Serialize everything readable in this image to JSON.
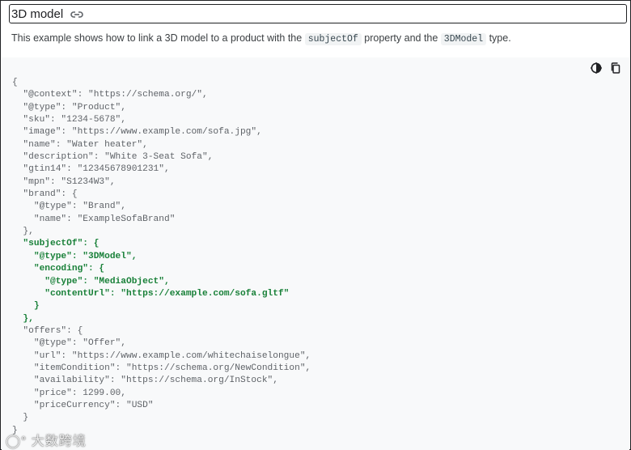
{
  "header": {
    "title": "3D model",
    "link_icon": "link-icon"
  },
  "description": {
    "prefix": "This example shows how to link a 3D model to a product with the ",
    "code1": "subjectOf",
    "middle": " property and the ",
    "code2": "3DModel",
    "suffix": " type."
  },
  "toolbar": {
    "theme_icon": "dark-mode-toggle-icon",
    "copy_icon": "copy-icon"
  },
  "code": {
    "lines": [
      "{",
      "  \"@context\": \"https://schema.org/\",",
      "  \"@type\": \"Product\",",
      "  \"sku\": \"1234-5678\",",
      "  \"image\": \"https://www.example.com/sofa.jpg\",",
      "  \"name\": \"Water heater\",",
      "  \"description\": \"White 3-Seat Sofa\",",
      "  \"gtin14\": \"12345678901231\",",
      "  \"mpn\": \"S1234W3\",",
      "  \"brand\": {",
      "    \"@type\": \"Brand\",",
      "    \"name\": \"ExampleSofaBrand\"",
      "  },",
      "  \"subjectOf\": {",
      "    \"@type\": \"3DModel\",",
      "    \"encoding\": {",
      "      \"@type\": \"MediaObject\",",
      "      \"contentUrl\": \"https://example.com/sofa.gltf\"",
      "    }",
      "  },",
      "  \"offers\": {",
      "    \"@type\": \"Offer\",",
      "    \"url\": \"https://www.example.com/whitechaiselongue\",",
      "    \"itemCondition\": \"https://schema.org/NewCondition\",",
      "    \"availability\": \"https://schema.org/InStock\",",
      "    \"price\": 1299.00,",
      "    \"priceCurrency\": \"USD\"",
      "  }",
      "}"
    ],
    "highlight_range": [
      13,
      19
    ],
    "highlight_color": "#188038"
  },
  "watermark": {
    "text": "大数跨境"
  }
}
